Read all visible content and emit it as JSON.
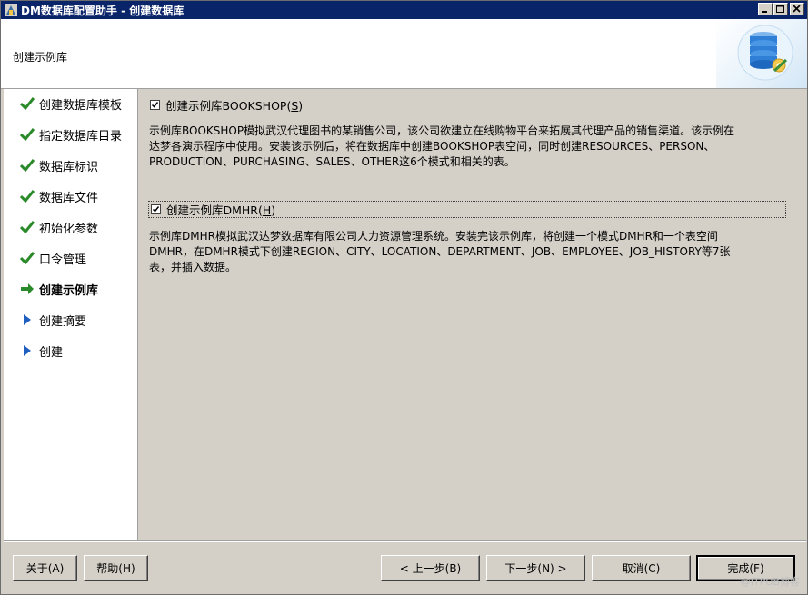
{
  "window": {
    "title": "DM数据库配置助手 - 创建数据库",
    "controls": [
      "minimize-icon",
      "maximize-icon",
      "close-icon"
    ]
  },
  "header": {
    "title": "创建示例库",
    "logo_icon": "database-gear-icon"
  },
  "sidebar": {
    "steps": [
      {
        "label": "创建数据库模板",
        "state": "done",
        "icon": "check-icon"
      },
      {
        "label": "指定数据库目录",
        "state": "done",
        "icon": "check-icon"
      },
      {
        "label": "数据库标识",
        "state": "done",
        "icon": "check-icon"
      },
      {
        "label": "数据库文件",
        "state": "done",
        "icon": "check-icon"
      },
      {
        "label": "初始化参数",
        "state": "done",
        "icon": "check-icon"
      },
      {
        "label": "口令管理",
        "state": "done",
        "icon": "check-icon"
      },
      {
        "label": "创建示例库",
        "state": "current",
        "icon": "arrow-right-icon"
      },
      {
        "label": "创建摘要",
        "state": "pending",
        "icon": "triangle-right-icon"
      },
      {
        "label": "创建",
        "state": "pending",
        "icon": "triangle-right-icon"
      }
    ]
  },
  "main": {
    "bookshop": {
      "label_prefix": "创建示例库BOOKSHOP(",
      "mnemonic": "S",
      "label_suffix": ")",
      "checked": true,
      "desc_line1": "示例库BOOKSHOP模拟武汉代理图书的某销售公司，该公司欲建立在线购物平台来拓展其代理产品的销售渠道。该示例在",
      "desc_line2": "达梦各演示程序中使用。安装该示例后，将在数据库中创建BOOKSHOP表空间，同时创建RESOURCES、PERSON、",
      "desc_line3": "PRODUCTION、PURCHASING、SALES、OTHER这6个模式和相关的表。"
    },
    "dmhr": {
      "label_prefix": "创建示例库DMHR(",
      "mnemonic": "H",
      "label_suffix": ")",
      "checked": true,
      "desc_line1": "示例库DMHR模拟武汉达梦数据库有限公司人力资源管理系统。安装完该示例库，将创建一个模式DMHR和一个表空间",
      "desc_line2": "DMHR，在DMHR模式下创建REGION、CITY、LOCATION、DEPARTMENT、JOB、EMPLOYEE、JOB_HISTORY等7张",
      "desc_line3": "表，并插入数据。"
    }
  },
  "footer": {
    "about": "关于(A)",
    "help": "帮助(H)",
    "prev": "< 上一步(B)",
    "next": "下一步(N) >",
    "cancel": "取消(C)",
    "finish": "完成(F)",
    "watermark": "@ITPUB博客"
  }
}
